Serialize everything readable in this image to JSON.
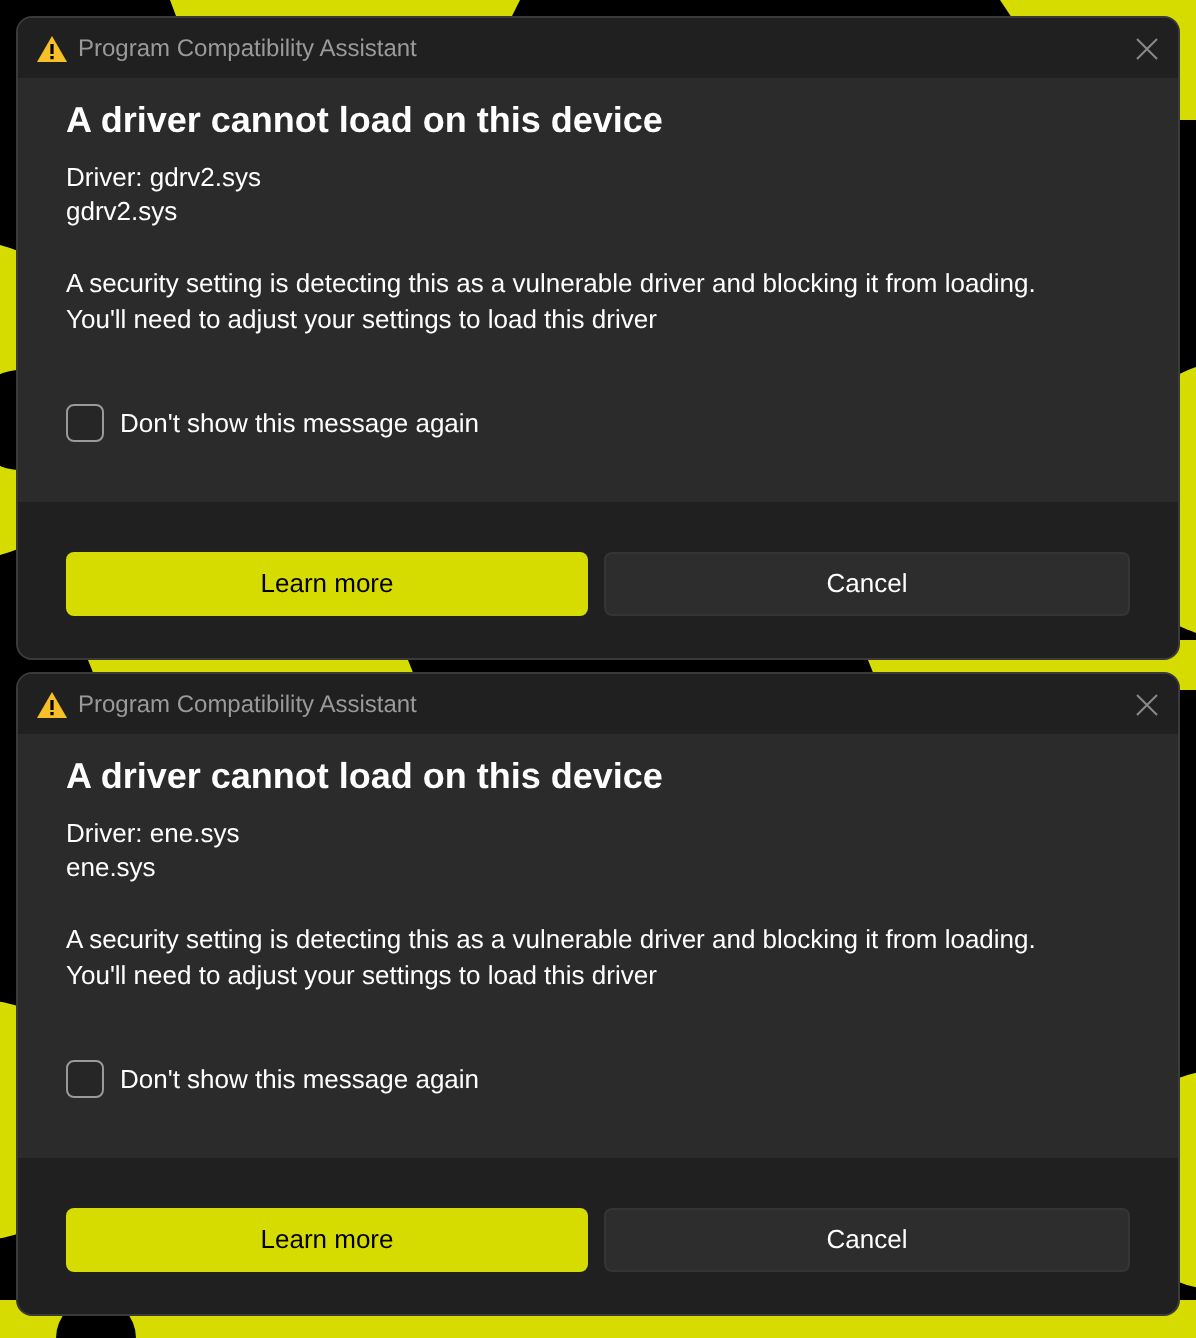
{
  "windows": [
    {
      "title": "Program Compatibility Assistant",
      "heading": "A driver cannot load on this device",
      "details": [
        "Driver: gdrv2.sys",
        "gdrv2.sys"
      ],
      "message": [
        "A security setting is detecting this as a vulnerable driver and blocking it from loading.",
        "You'll need to adjust your settings to load this driver"
      ],
      "checkbox": {
        "label": "Don't show this message again",
        "checked": false
      },
      "buttons": [
        {
          "label": "Learn more",
          "kind": "primary"
        },
        {
          "label": "Cancel",
          "kind": "secondary"
        }
      ]
    },
    {
      "title": "Program Compatibility Assistant",
      "heading": "A driver cannot load on this device",
      "details": [
        "Driver: ene.sys",
        "ene.sys"
      ],
      "message": [
        "A security setting is detecting this as a vulnerable driver and blocking it from loading.",
        "You'll need to adjust your settings to load this driver"
      ],
      "checkbox": {
        "label": "Don't show this message again",
        "checked": false
      },
      "buttons": [
        {
          "label": "Learn more",
          "kind": "primary"
        },
        {
          "label": "Cancel",
          "kind": "secondary"
        }
      ]
    }
  ]
}
